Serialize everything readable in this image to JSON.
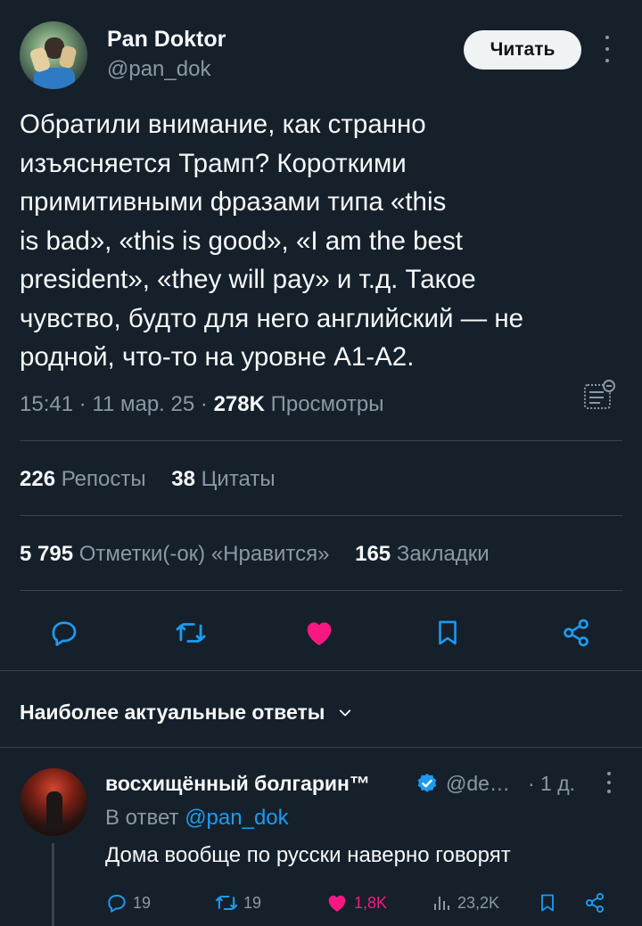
{
  "author": {
    "display_name": "Pan Doktor",
    "handle": "@pan_dok",
    "follow_label": "Читать"
  },
  "tweet": {
    "text_lines": [
      "Обратили внимание, как странно",
      "изъясняется Трамп? Короткими",
      "примитивными фразами типа «this",
      "is bad», «this is good», «I am the best",
      "president», «they will pay» и т.д. Такое",
      "чувство, будто для него английский — не",
      "родной, что-то на уровне A1-A2."
    ],
    "time": "15:41",
    "date": "11 мар. 25",
    "views_count": "278K",
    "views_label": "Просмотры"
  },
  "stats": {
    "reposts_count": "226",
    "reposts_label": "Репосты",
    "quotes_count": "38",
    "quotes_label": "Цитаты",
    "likes_count": "5 795",
    "likes_label": "Отметки(-ок) «Нравится»",
    "bookmarks_count": "165",
    "bookmarks_label": "Закладки"
  },
  "actions": {
    "icons": [
      "reply-icon",
      "retweet-icon",
      "like-icon",
      "bookmark-icon",
      "share-icon"
    ],
    "like_color": "#f91880"
  },
  "replies_header": {
    "label": "Наиболее актуальные ответы"
  },
  "reply": {
    "display_name": "восхищённый болгарин™",
    "handle": "@de…",
    "time": "· 1 д.",
    "reply_to_prefix": "В ответ",
    "reply_to_handle": "@pan_dok",
    "text": "Дома вообще по русски наверно говорят",
    "reply_count": "19",
    "retweet_count": "19",
    "like_count": "1,8K",
    "views_count": "23,2K"
  },
  "colors": {
    "background": "#15202b",
    "text": "#f7f9f9",
    "muted": "#8b98a5",
    "accent": "#1d9bf0",
    "like": "#f91880",
    "divider": "#38444d"
  }
}
